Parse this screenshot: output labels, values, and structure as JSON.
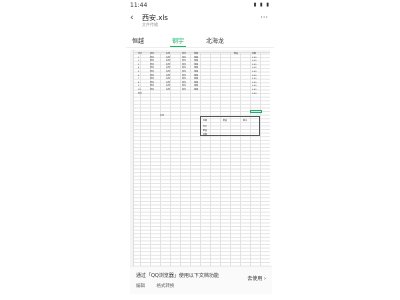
{
  "status": {
    "time": "11:44",
    "icons": "▮ ▮ ▮"
  },
  "header": {
    "title": "西安.xls",
    "subtitle": "文件传输",
    "back": "‹",
    "more": "···"
  },
  "tabs": [
    {
      "label": "恒越"
    },
    {
      "label": "钢宇"
    },
    {
      "label": "北海龙"
    }
  ],
  "active_tab": 1,
  "banner": {
    "text": "通过「QQ浏览器」使用以下文档功能",
    "button": "去使用 ›",
    "edit": "编辑",
    "format": "格式转换"
  },
  "rows": [
    [
      "序号",
      "项目",
      "名称",
      "单位",
      "规格",
      "数量",
      "金额"
    ],
    [
      "1",
      "项目",
      "名称",
      "单位",
      "规格",
      "",
      "0.00"
    ],
    [
      "2",
      "项目",
      "名称",
      "单位",
      "规格",
      "",
      "0.00"
    ],
    [
      "3",
      "项目",
      "名称",
      "单位",
      "规格",
      "",
      "0.00"
    ],
    [
      "4",
      "项目",
      "名称",
      "单位",
      "规格",
      "",
      "0.00"
    ],
    [
      "5",
      "项目",
      "名称",
      "单位",
      "规格",
      "",
      "0.00"
    ],
    [
      "6",
      "项目",
      "名称",
      "单位",
      "规格",
      "",
      "0.00"
    ],
    [
      "7",
      "项目",
      "名称",
      "单位",
      "规格",
      "",
      "0.00"
    ],
    [
      "8",
      "项目",
      "名称",
      "单位",
      "规格",
      "",
      "0.00"
    ],
    [
      "9",
      "项目",
      "名称",
      "单位",
      "规格",
      "",
      "0.00"
    ],
    [
      "10",
      "项目",
      "名称",
      "单位",
      "规格",
      "",
      "0.00"
    ],
    [
      "合计",
      "",
      "",
      "",
      "",
      "",
      "0.00"
    ]
  ],
  "mini": {
    "c1": "金额",
    "c2": "数量",
    "c3": "备注",
    "r1": "合计",
    "r2": "数量",
    "r3": "金额"
  },
  "note": "说明"
}
